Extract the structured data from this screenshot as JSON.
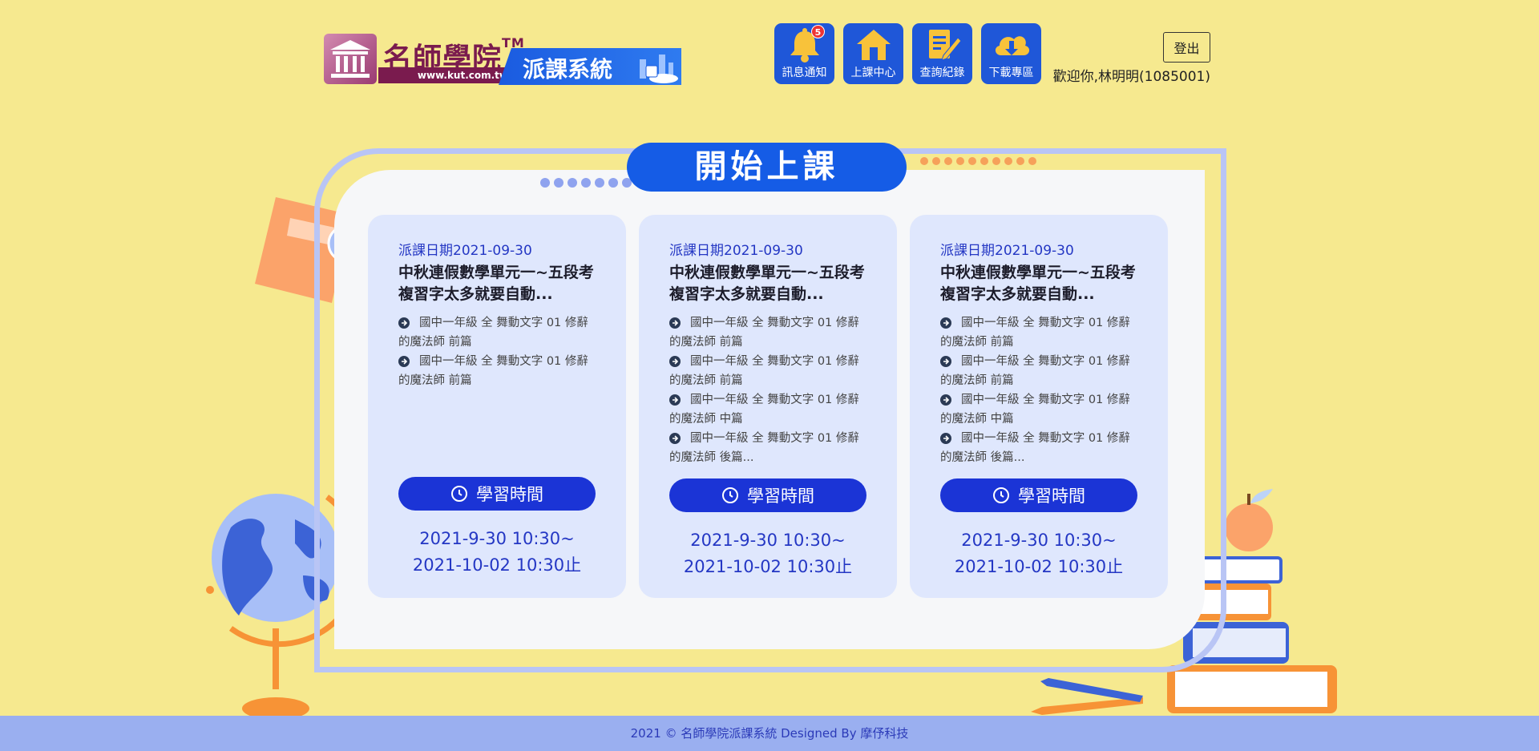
{
  "header": {
    "logo_title": "名師學院",
    "logo_tm": "TM",
    "logo_url": "www.kut.com.tw",
    "logo_system": "派課系統",
    "logout_label": "登出",
    "welcome": "歡迎你,林明明(1085001)"
  },
  "nav": [
    {
      "label": "訊息通知",
      "icon": "bell-icon",
      "badge": "5"
    },
    {
      "label": "上課中心",
      "icon": "home-icon"
    },
    {
      "label": "查詢紀錄",
      "icon": "document-edit-icon"
    },
    {
      "label": "下載專區",
      "icon": "cloud-download-icon"
    }
  ],
  "main": {
    "title": "開始上課"
  },
  "cards": [
    {
      "date": "派課日期2021-09-30",
      "title": "中秋連假數學單元一~五段考複習字太多就要自動...",
      "items": [
        "國中一年級 全 舞動文字 01 修辭的魔法師 前篇",
        "國中一年級 全 舞動文字 01 修辭的魔法師 前篇"
      ],
      "button": "學習時間",
      "time_start": "2021-9-30 10:30~",
      "time_end": "2021-10-02 10:30止"
    },
    {
      "date": "派課日期2021-09-30",
      "title": "中秋連假數學單元一~五段考複習字太多就要自動...",
      "items": [
        "國中一年級 全 舞動文字 01 修辭的魔法師 前篇",
        "國中一年級 全 舞動文字 01 修辭的魔法師 前篇",
        "國中一年級 全 舞動文字 01 修辭的魔法師 中篇",
        "國中一年級 全 舞動文字 01 修辭的魔法師 後篇..."
      ],
      "button": "學習時間",
      "time_start": "2021-9-30 10:30~",
      "time_end": "2021-10-02 10:30止"
    },
    {
      "date": "派課日期2021-09-30",
      "title": "中秋連假數學單元一~五段考複習字太多就要自動...",
      "items": [
        "國中一年級 全 舞動文字 01 修辭的魔法師 前篇",
        "國中一年級 全 舞動文字 01 修辭的魔法師 前篇",
        "國中一年級 全 舞動文字 01 修辭的魔法師 中篇",
        "國中一年級 全 舞動文字 01 修辭的魔法師 後篇..."
      ],
      "button": "學習時間",
      "time_start": "2021-9-30 10:30~",
      "time_end": "2021-10-02 10:30止"
    }
  ],
  "footer": {
    "text": "2021 © 名師學院派課系統 Designed By 摩伃科技"
  },
  "colors": {
    "background": "#f6e98f",
    "primary": "#155ce6",
    "button": "#1b34d6",
    "card": "#dfe7fd",
    "footer": "#9aaff0"
  }
}
